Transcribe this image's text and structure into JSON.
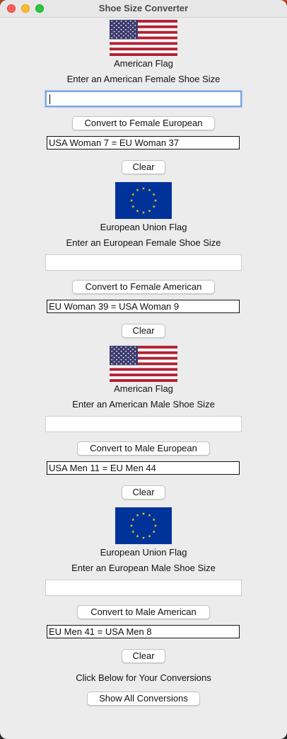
{
  "window": {
    "title": "Shoe Size Converter"
  },
  "sections": [
    {
      "flag_label": "American Flag",
      "prompt": "Enter an American Female Shoe Size",
      "input_value": "",
      "convert_label": "Convert to Female European",
      "result": "USA Woman 7 = EU Woman 37",
      "clear_label": "Clear",
      "flag_icon": "us-flag-icon"
    },
    {
      "flag_label": "European Union Flag",
      "prompt": "Enter an European Female Shoe Size",
      "input_value": "",
      "convert_label": "Convert to Female American",
      "result": "EU Woman 39 = USA Woman 9",
      "clear_label": "Clear",
      "flag_icon": "eu-flag-icon"
    },
    {
      "flag_label": "American Flag",
      "prompt": "Enter an American Male Shoe Size",
      "input_value": "",
      "convert_label": "Convert to Male European",
      "result": "USA Men 11 = EU Men 44",
      "clear_label": "Clear",
      "flag_icon": "us-flag-icon"
    },
    {
      "flag_label": "European Union Flag",
      "prompt": "Enter an European Male Shoe Size",
      "input_value": "",
      "convert_label": "Convert to Male American",
      "result": "EU Men 41 = USA Men 8",
      "clear_label": "Clear",
      "flag_icon": "eu-flag-icon"
    }
  ],
  "footer": {
    "caption": "Click Below for Your Conversions",
    "show_all_label": "Show All Conversions"
  },
  "colors": {
    "us_red": "#b22234",
    "us_blue": "#3c3b6e",
    "eu_blue": "#003399",
    "eu_star": "#ffcc00"
  }
}
